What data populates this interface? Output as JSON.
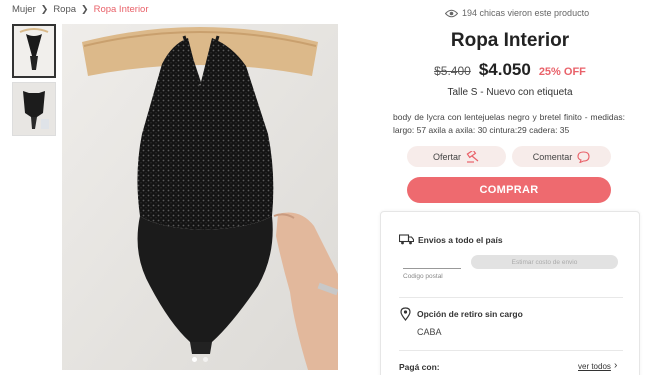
{
  "breadcrumb": {
    "items": [
      "Mujer",
      "Ropa"
    ],
    "current": "Ropa Interior"
  },
  "views": {
    "text": "194 chicas vieron este producto"
  },
  "product": {
    "title": "Ropa Interior",
    "old_price": "$5.400",
    "price": "$4.050",
    "discount": "25% OFF",
    "size_condition": "Talle S - Nuevo con etiqueta",
    "description": "body de lycra con lentejuelas negro y bretel finito - medidas: largo: 57 axila a axila: 30 cintura:29 cadera: 35"
  },
  "actions": {
    "offer_label": "Ofertar",
    "comment_label": "Comentar",
    "buy_label": "COMPRAR"
  },
  "shipping": {
    "title": "Envios a todo el país",
    "postal_label": "Codigo postal",
    "estimate_label": "Estimar costo de envio"
  },
  "pickup": {
    "title": "Opción de retiro sin cargo",
    "location": "CABA"
  },
  "payment": {
    "title": "Pagá con:",
    "see_all": "ver todos"
  },
  "carousel": {
    "count": 2,
    "active_index": 0
  },
  "colors": {
    "accent": "#ee6a6f",
    "discount": "#e9626a",
    "pill_bg": "#f7ecea"
  },
  "icons": [
    "chevron-right-icon",
    "eye-icon",
    "offer-hammer-icon",
    "comment-bubble-icon",
    "truck-icon",
    "location-pin-icon"
  ]
}
